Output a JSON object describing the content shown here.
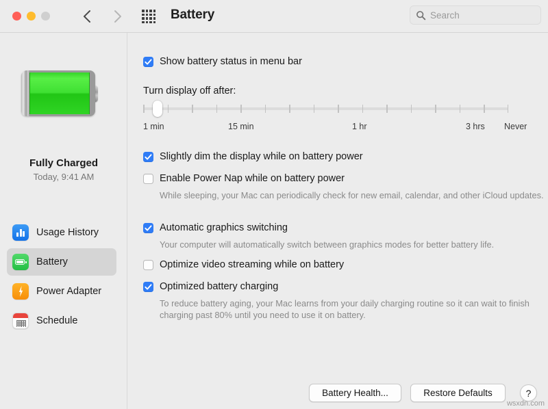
{
  "window": {
    "title": "Battery",
    "traffic_lights": [
      "close",
      "minimize",
      "zoom"
    ],
    "nav": {
      "back": "back-chevron",
      "forward": "forward-chevron",
      "grid": "show-all-grid"
    },
    "search": {
      "placeholder": "Search",
      "value": "",
      "icon": "search-icon"
    }
  },
  "sidebar": {
    "hero": {
      "icon": "battery-full-green",
      "status": "Fully Charged",
      "timestamp": "Today, 9:41 AM"
    },
    "items": [
      {
        "label": "Usage History",
        "icon": "usage-history-icon",
        "selected": false
      },
      {
        "label": "Battery",
        "icon": "battery-icon",
        "selected": true
      },
      {
        "label": "Power Adapter",
        "icon": "power-adapter-icon",
        "selected": false
      },
      {
        "label": "Schedule",
        "icon": "schedule-icon",
        "selected": false
      }
    ]
  },
  "main": {
    "menu_bar_checkbox": {
      "label": "Show battery status in menu bar",
      "checked": true
    },
    "display_off": {
      "label": "Turn display off after:",
      "tick_labels": [
        "1 min",
        "15 min",
        "1 hr",
        "3 hrs",
        "Never"
      ],
      "tick_count": 16,
      "value": "1 min",
      "knob_position_pct": 3
    },
    "options": [
      {
        "label": "Slightly dim the display while on battery power",
        "checked": true,
        "description": ""
      },
      {
        "label": "Enable Power Nap while on battery power",
        "checked": false,
        "description": "While sleeping, your Mac can periodically check for new email, calendar, and other iCloud updates."
      },
      {
        "label": "Automatic graphics switching",
        "checked": true,
        "description": "Your computer will automatically switch between graphics modes for better battery life."
      },
      {
        "label": "Optimize video streaming while on battery",
        "checked": false,
        "description": ""
      },
      {
        "label": "Optimized battery charging",
        "checked": true,
        "description": "To reduce battery aging, your Mac learns from your daily charging routine so it can wait to finish charging past 80% until you need to use it on battery."
      }
    ]
  },
  "footer": {
    "battery_health_button": "Battery Health...",
    "restore_defaults_button": "Restore Defaults",
    "help_button": "?"
  },
  "watermark": "wsxdn.com",
  "colors": {
    "accent_blue": "#2f7cf6",
    "battery_green": "#35d42a",
    "window_bg": "#ececec",
    "selected_row": "#d5d5d5"
  }
}
